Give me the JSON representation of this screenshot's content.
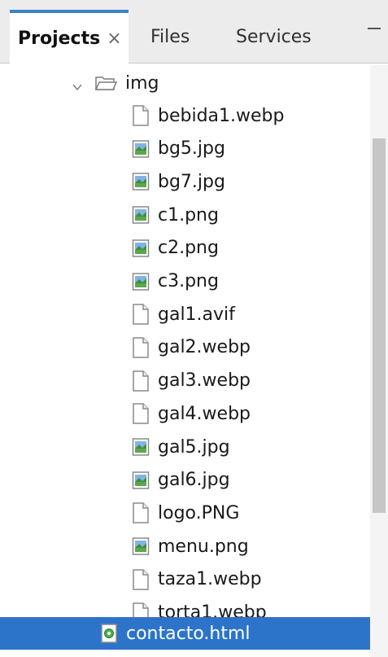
{
  "tabs": {
    "projects": "Projects",
    "projects_close": "×",
    "files": "Files",
    "services": "Services"
  },
  "tree": {
    "folder": {
      "label": "img",
      "icon": "folder-open-icon",
      "expanded": true
    },
    "files": [
      {
        "label": "bebida1.webp",
        "icon": "generic-file-icon"
      },
      {
        "label": "bg5.jpg",
        "icon": "image-file-icon"
      },
      {
        "label": "bg7.jpg",
        "icon": "image-file-icon"
      },
      {
        "label": "c1.png",
        "icon": "image-file-icon"
      },
      {
        "label": "c2.png",
        "icon": "image-file-icon"
      },
      {
        "label": "c3.png",
        "icon": "image-file-icon"
      },
      {
        "label": "gal1.avif",
        "icon": "generic-file-icon"
      },
      {
        "label": "gal2.webp",
        "icon": "generic-file-icon"
      },
      {
        "label": "gal3.webp",
        "icon": "generic-file-icon"
      },
      {
        "label": "gal4.webp",
        "icon": "generic-file-icon"
      },
      {
        "label": "gal5.jpg",
        "icon": "image-file-icon"
      },
      {
        "label": "gal6.jpg",
        "icon": "image-file-icon"
      },
      {
        "label": "logo.PNG",
        "icon": "generic-file-icon"
      },
      {
        "label": "menu.png",
        "icon": "image-file-icon"
      },
      {
        "label": "taza1.webp",
        "icon": "generic-file-icon"
      },
      {
        "label": "torta1.webp",
        "icon": "generic-file-icon"
      }
    ],
    "selected": {
      "label": "contacto.html",
      "icon": "html-file-icon"
    }
  },
  "colors": {
    "accent": "#3b84c4",
    "selection": "#2c74c9",
    "image_icon_green": "#5aa84a",
    "image_icon_blue": "#4a90d9"
  }
}
